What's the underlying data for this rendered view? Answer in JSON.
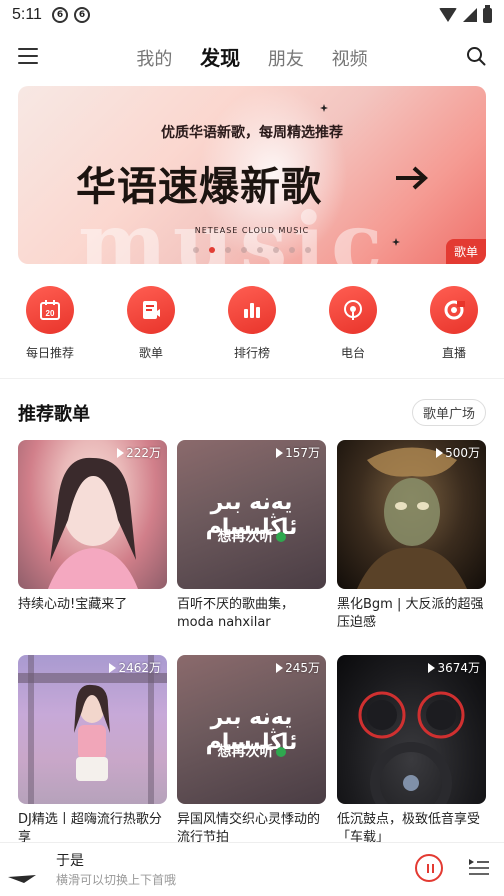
{
  "status": {
    "time": "5:11"
  },
  "nav": {
    "tabs": [
      "我的",
      "发现",
      "朋友",
      "视频"
    ],
    "active": 1
  },
  "banner": {
    "subtitle": "优质华语新歌，每周精选推荐",
    "title": "华语速爆新歌",
    "bg_word": "music",
    "brand": "NETEASE CLOUD MUSIC",
    "tag": "歌单",
    "page_count": 8,
    "active_page": 1
  },
  "shortcuts": [
    {
      "label": "每日推荐",
      "icon": "calendar-icon",
      "badge": "20"
    },
    {
      "label": "歌单",
      "icon": "playlist-icon"
    },
    {
      "label": "排行榜",
      "icon": "chart-icon"
    },
    {
      "label": "电台",
      "icon": "radio-icon"
    },
    {
      "label": "直播",
      "icon": "live-icon"
    }
  ],
  "section": {
    "title": "推荐歌单",
    "more": "歌单广场"
  },
  "playlists": [
    {
      "plays": "222万",
      "title": "持续心动!宝藏来了",
      "cover": "girl1"
    },
    {
      "plays": "157万",
      "title": "百听不厌的歌曲集，moda nahxilar",
      "cover": "arabic",
      "cover_ar": "يەنە بىر ئاڭلىسام",
      "cover_cn": "想再次听"
    },
    {
      "plays": "500万",
      "title": "黑化Bgm | 大反派的超强压迫感",
      "cover": "dark"
    },
    {
      "plays": "2462万",
      "title": "DJ精选丨超嗨流行热歌分享",
      "cover": "girl2"
    },
    {
      "plays": "245万",
      "title": "异国风情交织心灵悸动的流行节拍",
      "cover": "arabic",
      "cover_ar": "يەنە بىر ئاڭلىسام",
      "cover_cn": "想再次听"
    },
    {
      "plays": "3674万",
      "title": "低沉鼓点，极致低音享受「车载」",
      "cover": "car"
    }
  ],
  "player": {
    "song": "于是",
    "hint": "横滑可以切换上下首哦"
  },
  "colors": {
    "accent": "#e33a32"
  }
}
